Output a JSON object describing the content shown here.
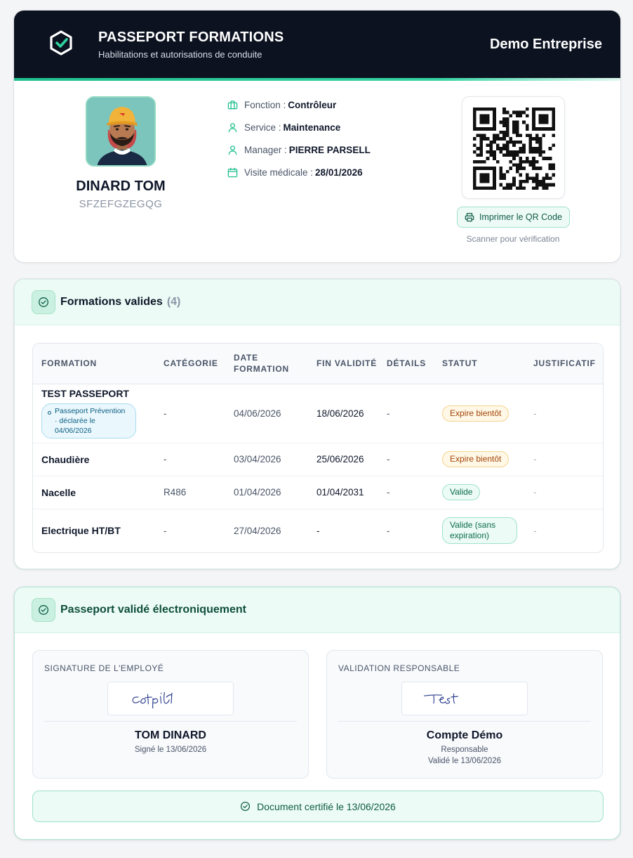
{
  "header": {
    "title": "PASSEPORT FORMATIONS",
    "subtitle": "Habilitations et autorisations de conduite",
    "company": "Demo Entreprise"
  },
  "employee": {
    "name": "DINARD TOM",
    "id": "SFZEFGZEGQG",
    "fields": [
      {
        "icon": "briefcase-icon",
        "label": "Fonction :",
        "value": "Contrôleur"
      },
      {
        "icon": "user-icon",
        "label": "Service :",
        "value": "Maintenance"
      },
      {
        "icon": "user-icon",
        "label": "Manager :",
        "value": "PIERRE PARSELL"
      },
      {
        "icon": "calendar-icon",
        "label": "Visite médicale :",
        "value": "28/01/2026"
      }
    ]
  },
  "qr": {
    "print_label": "Imprimer le QR Code",
    "hint": "Scanner pour vérification"
  },
  "formations": {
    "title": "Formations valides",
    "count": "(4)",
    "columns": [
      "FORMATION",
      "CATÉGORIE",
      "DATE FORMATION",
      "FIN VALIDITÉ",
      "DÉTAILS",
      "STATUT",
      "JUSTIFICATIF"
    ],
    "rows": [
      {
        "name": "TEST PASSEPORT",
        "badge": "Passeport Prévention · déclarée le 04/06/2026",
        "category": "-",
        "date": "04/06/2026",
        "end": "18/06/2026",
        "details": "-",
        "status": "Expire bientôt",
        "status_type": "warn",
        "proof": "-"
      },
      {
        "name": "Chaudière",
        "badge": "",
        "category": "-",
        "date": "03/04/2026",
        "end": "25/06/2026",
        "details": "-",
        "status": "Expire bientôt",
        "status_type": "warn",
        "proof": "-"
      },
      {
        "name": "Nacelle",
        "badge": "",
        "category": "R486",
        "date": "01/04/2026",
        "end": "01/04/2031",
        "details": "-",
        "status": "Valide",
        "status_type": "ok",
        "proof": "-"
      },
      {
        "name": "Electrique HT/BT",
        "badge": "",
        "category": "-",
        "date": "27/04/2026",
        "end": "-",
        "details": "-",
        "status": "Valide (sans expiration)",
        "status_type": "ok",
        "proof": "-"
      }
    ]
  },
  "validation": {
    "title": "Passeport validé électroniquement",
    "employee_sig": {
      "label": "SIGNATURE DE L'EMPLOYÉ",
      "name": "TOM DINARD",
      "signed": "Signé le 13/06/2026"
    },
    "manager_sig": {
      "label": "VALIDATION RESPONSABLE",
      "name": "Compte Démo",
      "role": "Responsable",
      "validated": "Validé le 13/06/2026"
    },
    "certified": "Document certifié le 13/06/2026"
  },
  "colors": {
    "accent": "#1fbf8f",
    "dark": "#0c1220",
    "warn": "#a2440a",
    "ok": "#0c6b4d"
  }
}
